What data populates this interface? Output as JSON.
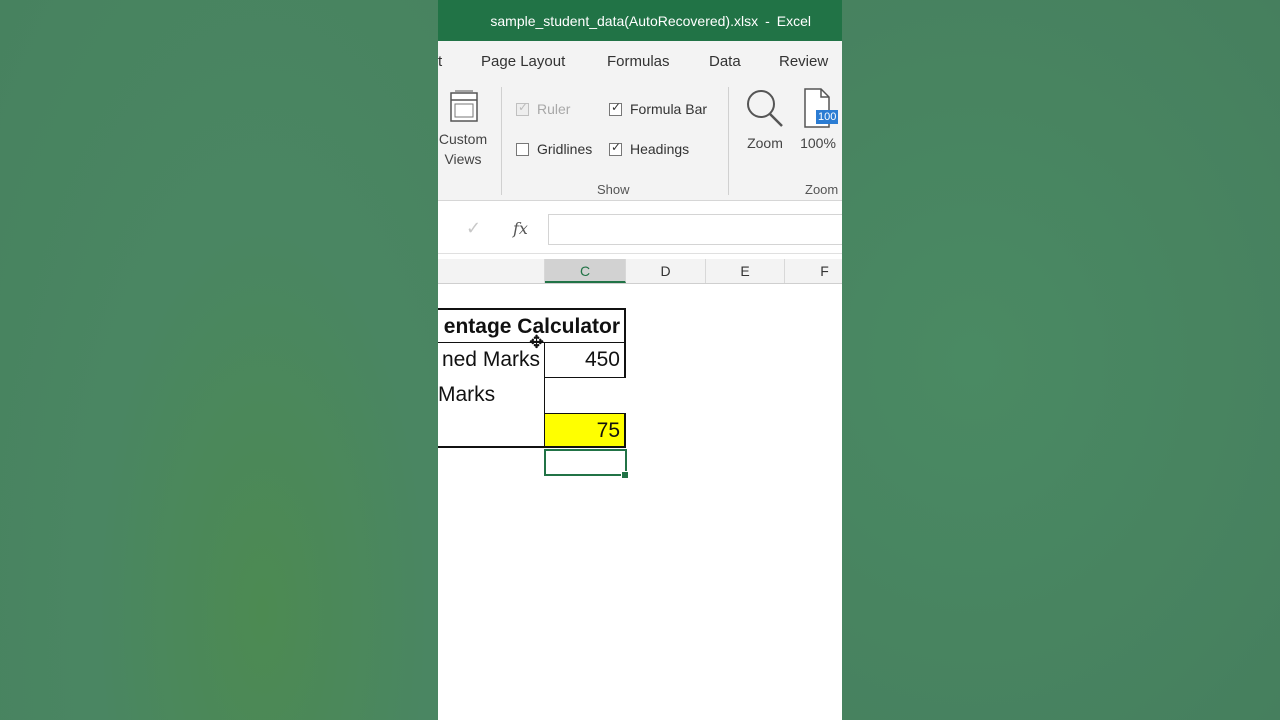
{
  "window": {
    "filename": "sample_student_data(AutoRecovered).xlsx",
    "separator": "-",
    "app": "Excel"
  },
  "tabs": [
    {
      "label": "t"
    },
    {
      "label": "Page Layout"
    },
    {
      "label": "Formulas"
    },
    {
      "label": "Data"
    },
    {
      "label": "Review"
    }
  ],
  "ribbon": {
    "custom_views": {
      "line1": "Custom",
      "line2": "Views"
    },
    "show": {
      "ruler": "Ruler",
      "formula_bar": "Formula Bar",
      "gridlines": "Gridlines",
      "headings": "Headings",
      "group_label": "Show"
    },
    "zoom": {
      "zoom_label": "Zoom",
      "pct_label": "100%",
      "badge": "100",
      "group_label": "Zoom"
    }
  },
  "formula_bar": {
    "check": "✓",
    "fx": "fx",
    "value": ""
  },
  "columns": [
    "C",
    "D",
    "E",
    "F"
  ],
  "sheet": {
    "title": "entage Calculator",
    "rows": [
      {
        "label": "ned Marks",
        "value": "450"
      },
      {
        "label": "Marks",
        "value": ""
      },
      {
        "label": "",
        "value": "75"
      }
    ]
  },
  "colors": {
    "excel_green": "#217346",
    "highlight": "#ffff00"
  }
}
